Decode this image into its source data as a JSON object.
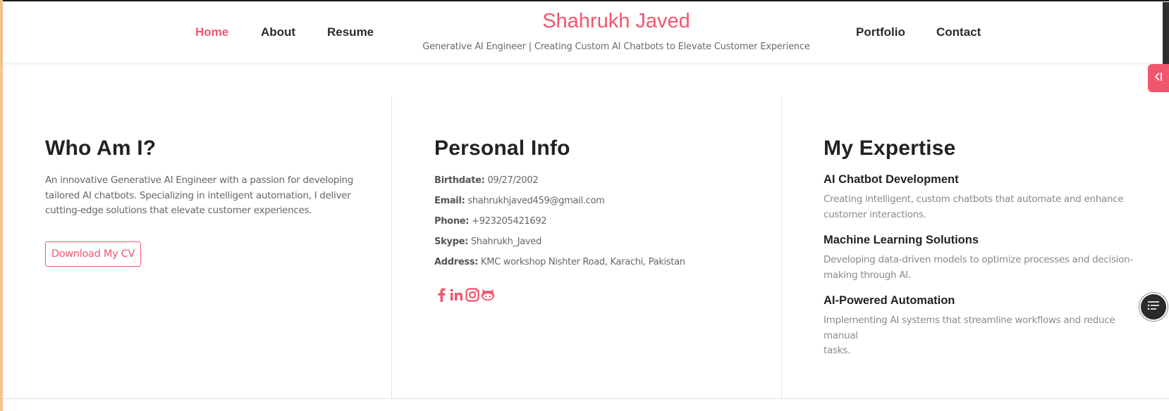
{
  "header": {
    "brand_name": "Shahrukh Javed",
    "tagline": "Generative AI Engineer | Creating Custom AI Chatbots to Elevate Customer Experience",
    "nav_left": [
      "Home",
      "About",
      "Resume"
    ],
    "nav_right": [
      "Portfolio",
      "Contact"
    ],
    "active": "Home"
  },
  "about": {
    "title": "Who Am I?",
    "lines": [
      "An innovative Generative AI Engineer with a passion for developing",
      "tailored AI chatbots. Specializing in intelligent automation, I deliver",
      "cutting-edge solutions that elevate customer experiences."
    ],
    "cv_button": "Download My CV"
  },
  "personal_info": {
    "title": "Personal Info",
    "fields": [
      {
        "label": "Birthdate:",
        "value": "09/27/2002"
      },
      {
        "label": "Email:",
        "value": "shahrukhjaved459@gmail.com"
      },
      {
        "label": "Phone:",
        "value": "+923205421692"
      },
      {
        "label": "Skype:",
        "value": "Shahrukh_Javed"
      },
      {
        "label": "Address:",
        "value": "KMC workshop Nishter Road, Karachi, Pakistan"
      }
    ],
    "socials": [
      "facebook-icon",
      "linkedin-icon",
      "instagram-icon",
      "github-icon"
    ]
  },
  "expertise": {
    "title": "My Expertise",
    "items": [
      {
        "heading": "AI Chatbot Development",
        "lines": [
          "Creating intelligent, custom chatbots that automate and enhance",
          "customer interactions."
        ]
      },
      {
        "heading": "Machine Learning Solutions",
        "lines": [
          "Developing data-driven models to optimize processes and decision-",
          "making through AI."
        ]
      },
      {
        "heading": "AI-Powered Automation",
        "lines": [
          "Implementing AI systems that streamline workflows and reduce manual",
          "tasks."
        ]
      }
    ]
  },
  "widgets": {
    "side_toggle_icon": "arrow-collapse-icon",
    "floating_icon": "list-menu-icon"
  },
  "colors": {
    "accent": "#f0566e",
    "heading": "#222222",
    "text": "#666666"
  }
}
